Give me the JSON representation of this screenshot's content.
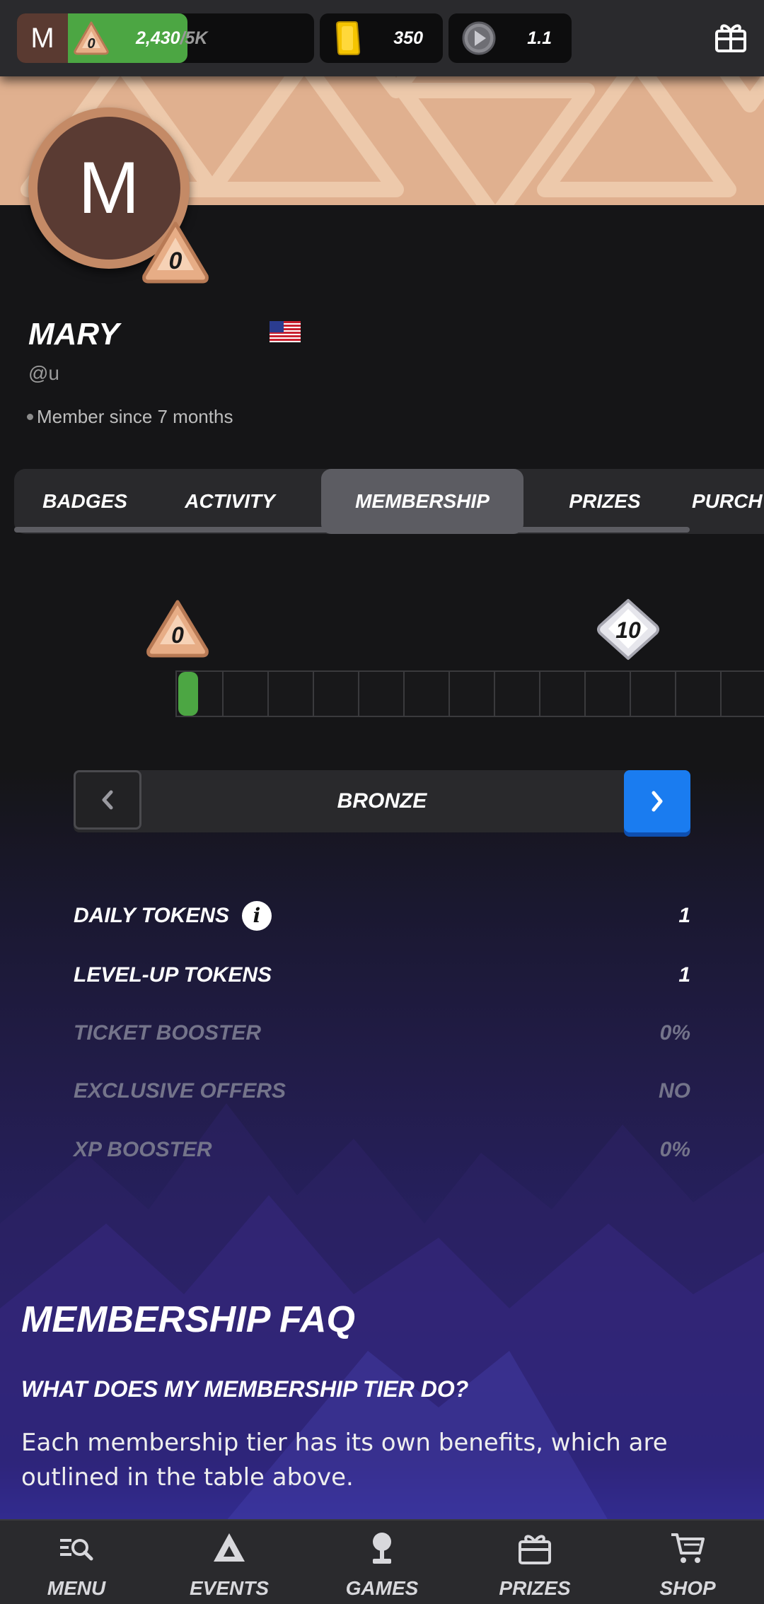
{
  "topbar": {
    "avatar_initial": "M",
    "xp_level": "0",
    "xp_current": "2,430",
    "xp_max": "/5K",
    "xp_progress": 0.486,
    "tickets": "350",
    "coins": "1.1",
    "icons": {
      "ticket": "ticket-icon",
      "coin": "coin-icon",
      "gift": "gift-icon"
    }
  },
  "profile": {
    "avatar_initial": "M",
    "level": "0",
    "name": "MARY",
    "flag": "us-flag-icon",
    "handle": "@u",
    "member_since": "Member since 7 months"
  },
  "tabs": [
    {
      "label": "BADGES"
    },
    {
      "label": "ACTIVITY"
    },
    {
      "label": "MEMBERSHIP",
      "active": true
    },
    {
      "label": "PRIZES"
    },
    {
      "label": "PURCH"
    }
  ],
  "level_track": {
    "start_level": "0",
    "next_level": "10",
    "progress_segments_filled": 0
  },
  "tier": {
    "name": "BRONZE"
  },
  "benefits": [
    {
      "label": "DAILY TOKENS",
      "value": "1",
      "info": true,
      "enabled": true
    },
    {
      "label": "LEVEL-UP TOKENS",
      "value": "1",
      "enabled": true
    },
    {
      "label": "TICKET BOOSTER",
      "value": "0%",
      "enabled": false
    },
    {
      "label": "EXCLUSIVE OFFERS",
      "value": "NO",
      "enabled": false
    },
    {
      "label": "XP BOOSTER",
      "value": "0%",
      "enabled": false
    }
  ],
  "faq": {
    "title": "MEMBERSHIP FAQ",
    "question": "WHAT DOES MY MEMBERSHIP TIER DO?",
    "answer": "Each membership tier has its own benefits, which are outlined in the table above."
  },
  "bottomnav": [
    {
      "label": "MENU",
      "icon": "menu-search-icon"
    },
    {
      "label": "EVENTS",
      "icon": "triangle-icon"
    },
    {
      "label": "GAMES",
      "icon": "joystick-icon"
    },
    {
      "label": "PRIZES",
      "icon": "prize-box-icon"
    },
    {
      "label": "SHOP",
      "icon": "cart-icon"
    }
  ],
  "colors": {
    "xp_green": "#4ca643",
    "accent_blue": "#1a7cf0",
    "bronze": "#e0b08f",
    "background": "#151517"
  }
}
